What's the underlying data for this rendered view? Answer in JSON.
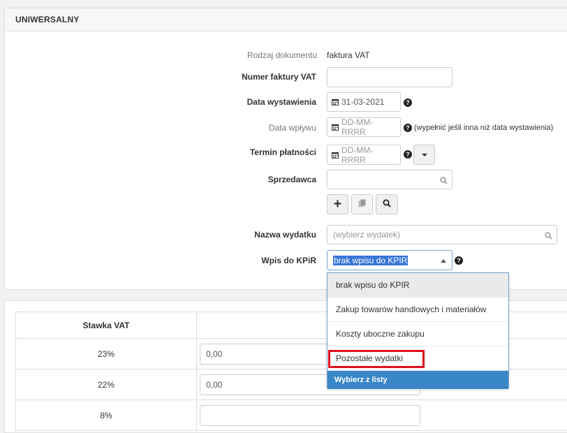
{
  "panel": {
    "title": "UNIWERSALNY"
  },
  "form": {
    "doc_type": {
      "label": "Rodzaj dokumentu",
      "value": "faktura VAT"
    },
    "invoice_number": {
      "label": "Numer faktury VAT",
      "value": ""
    },
    "issue_date": {
      "label": "Data wystawienia",
      "value": "31-03-2021"
    },
    "receipt_date": {
      "label": "Data wpływu",
      "placeholder": "DD-MM-RRRR",
      "hint": "(wypełnić jeśli inna niż data wystawienia)"
    },
    "payment_term": {
      "label": "Termin płatności",
      "placeholder": "DD-MM-RRRR"
    },
    "seller": {
      "label": "Sprzedawca",
      "value": ""
    },
    "expense_name": {
      "label": "Nazwa wydatku",
      "placeholder": "(wybierz wydatek)"
    },
    "kpir": {
      "label": "Wpis do KPiR",
      "value": "brak wpisu do KPIR"
    }
  },
  "dropdown": {
    "options": [
      "brak wpisu do KPIR",
      "Zakup towarów handlowych i materiałów",
      "Koszty uboczne zakupu",
      "Pozostałe wydatki"
    ],
    "footer": "Wybierz z listy"
  },
  "vat_table": {
    "header": "Stawka VAT",
    "rows": [
      {
        "rate": "23%",
        "value": "0,00"
      },
      {
        "rate": "22%",
        "value": "0,00"
      },
      {
        "rate": "8%",
        "value": ""
      }
    ]
  },
  "colors": {
    "accent": "#3a87c8",
    "highlight_border": "#e0101e"
  },
  "icons": {
    "calendar": "calendar-icon",
    "help": "question-circle-icon",
    "search": "search-icon",
    "plus": "plus-icon",
    "copy": "copy-icon",
    "caret": "caret-down-icon"
  }
}
